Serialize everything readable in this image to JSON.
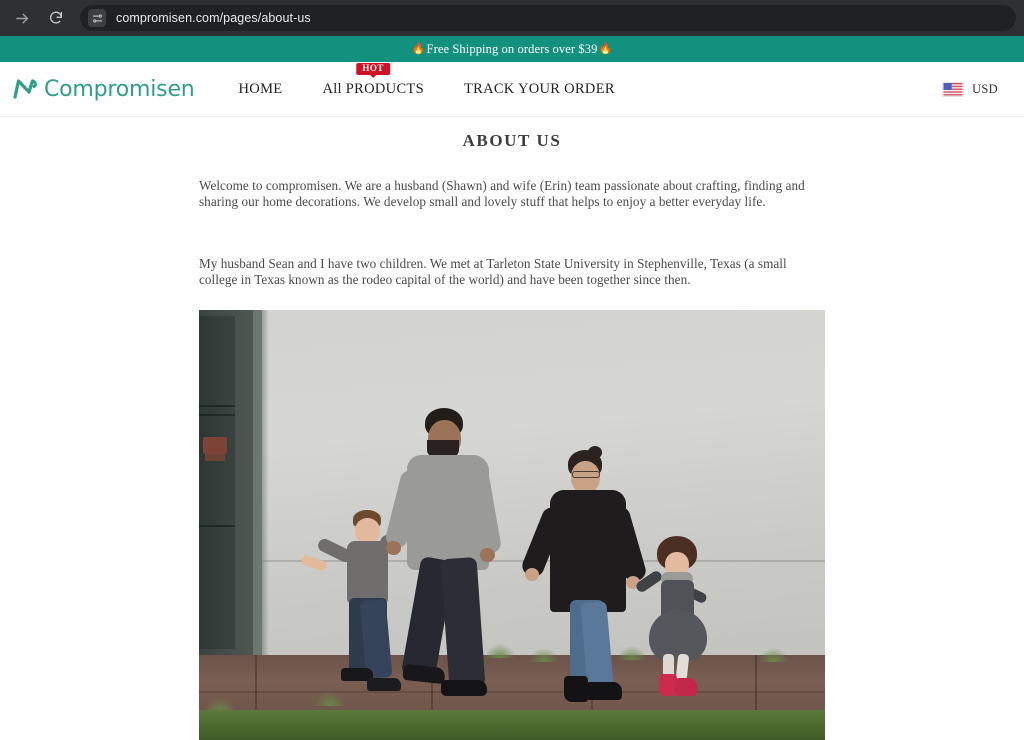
{
  "browser": {
    "forward_icon": "forward-arrow-icon",
    "reload_icon": "reload-icon",
    "site_settings_icon": "site-settings-icon",
    "url": "compromisen.com/pages/about-us"
  },
  "promo": {
    "flame_left": "🔥",
    "text": "Free Shipping on orders over $39",
    "flame_right": "🔥",
    "background_color": "#12917f"
  },
  "header": {
    "brand_mark_icon": "compromisen-logo-icon",
    "brand_name": "Compromisen",
    "brand_color": "#2f9e8b",
    "nav": [
      {
        "label": "HOME",
        "badge": null
      },
      {
        "label": "All PRODUCTS",
        "badge": "HOT"
      },
      {
        "label": "TRACK YOUR ORDER",
        "badge": null
      }
    ],
    "badge_color": "#cf1125",
    "currency": {
      "flag_icon": "us-flag-icon",
      "label": "USD"
    }
  },
  "main": {
    "title": "ABOUT US",
    "paragraphs": [
      "Welcome to compromisen. We are a husband (Shawn) and wife (Erin) team passionate about crafting, finding and sharing our home decorations. We develop small and lovely stuff that helps to enjoy a better everyday life.",
      "My husband Sean and I have two children. We met at Tarleton State University in Stephenville, Texas (a small college in Texas known as the rodeo capital of the world) and have been together since then."
    ],
    "photo": {
      "alt": "family-walking-photo"
    }
  }
}
